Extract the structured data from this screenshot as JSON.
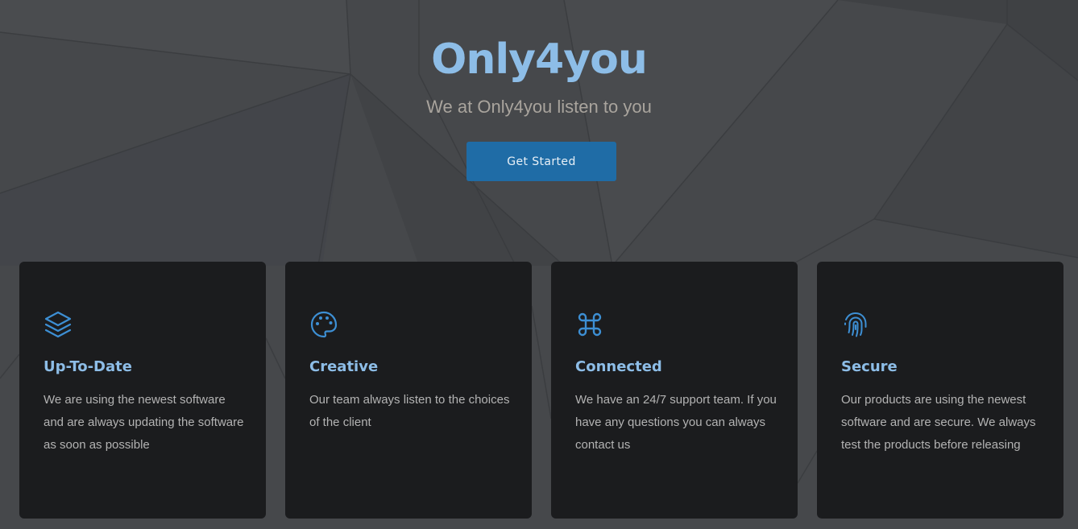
{
  "colors": {
    "background": "#46484b",
    "accent": "#8dbde7",
    "icon": "#3d8fd4",
    "button": "#1f6ca6",
    "card": "#1b1c1e",
    "subtitle": "#a9a49d"
  },
  "hero": {
    "title": "Only4you",
    "subtitle": "We at Only4you listen to you",
    "cta_label": "Get Started"
  },
  "features": [
    {
      "icon": "layers-icon",
      "title": "Up-To-Date",
      "description": "We are using the newest software and are always updating the software as soon as possible"
    },
    {
      "icon": "palette-icon",
      "title": "Creative",
      "description": "Our team always listen to the choices of the client"
    },
    {
      "icon": "command-icon",
      "title": "Connected",
      "description": "We have an 24/7 support team. If you have any questions you can always contact us"
    },
    {
      "icon": "fingerprint-icon",
      "title": "Secure",
      "description": "Our products are using the newest software and are secure. We always test the products before releasing"
    }
  ]
}
